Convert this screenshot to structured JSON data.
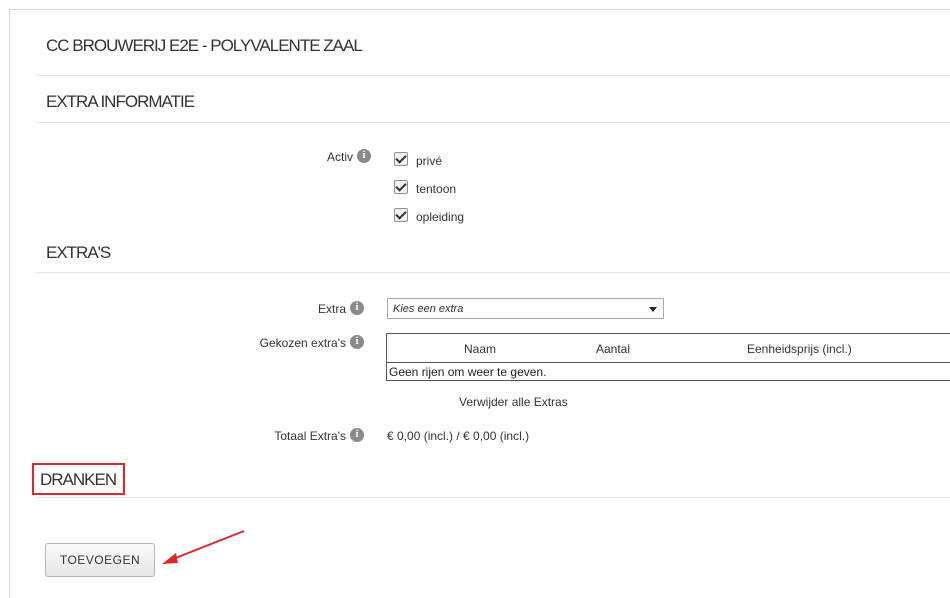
{
  "page": {
    "title": "CC BROUWERIJ E2E  - POLYVALENTE ZAAL"
  },
  "sections": {
    "extra_info": "EXTRA INFORMATIE",
    "extras": "EXTRA'S",
    "dranken": "DRANKEN"
  },
  "activ": {
    "label": "Activ",
    "options": [
      {
        "label": "privé",
        "checked": true
      },
      {
        "label": "tentoon",
        "checked": true
      },
      {
        "label": "opleiding",
        "checked": true
      }
    ]
  },
  "extra": {
    "label": "Extra",
    "select_value": "Kies een extra"
  },
  "chosen": {
    "label": "Gekozen extra's",
    "columns": [
      "Naam",
      "Aantal",
      "Eenheidsprijs (incl.)"
    ],
    "empty_text": "Geen rijen om weer te geven."
  },
  "remove_all": "Verwijder alle Extras",
  "total": {
    "label": "Totaal Extra's",
    "value": "€ 0,00 (incl.) / € 0,00 (incl.)"
  },
  "add_button": "TOEVOEGEN",
  "colors": {
    "highlight": "#e0252b",
    "arrow": "#e0252b"
  }
}
